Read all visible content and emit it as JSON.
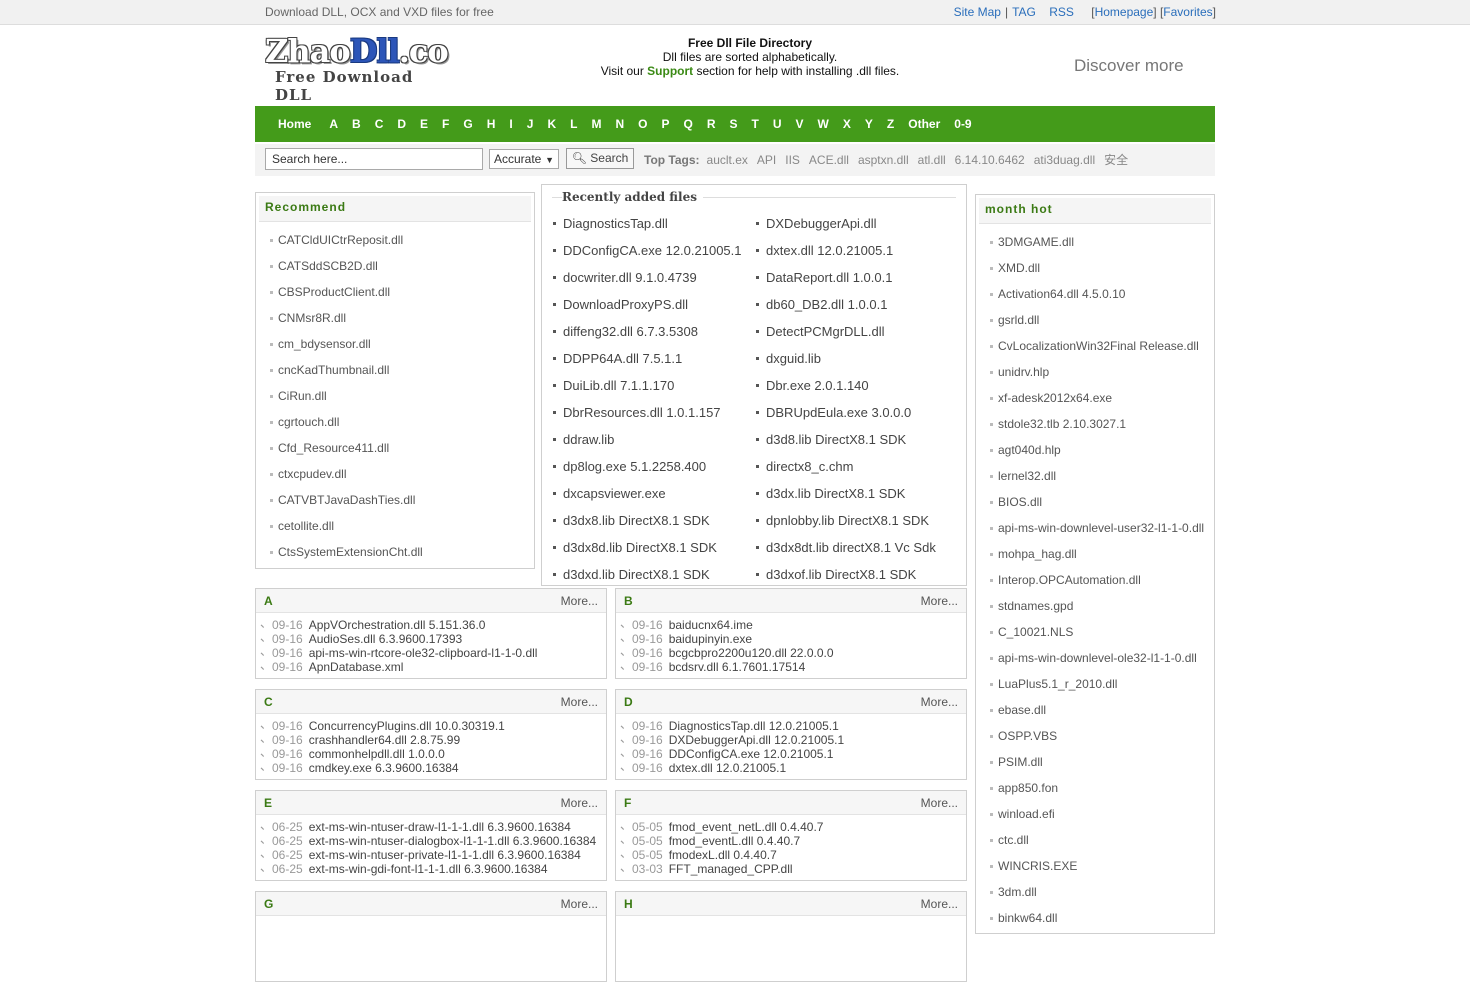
{
  "topbar": {
    "tagline": "Download DLL, OCX and VXD files for free",
    "links": [
      "Site Map",
      "TAG",
      "RSS"
    ],
    "homepage": "Homepage",
    "favorites": "Favorites"
  },
  "logo": {
    "brand_a": "Zhao",
    "brand_b": "Dll",
    "brand_c": ".co",
    "sub": "Free Download DLL"
  },
  "intro": {
    "title": "Free Dll File Directory",
    "line1": "Dll files are sorted alphabetically.",
    "line2_pre": "Visit our ",
    "support": "Support",
    "line2_post": " section for help with installing .dll files."
  },
  "discover": "Discover more",
  "nav": [
    "Home",
    "A",
    "B",
    "C",
    "D",
    "E",
    "F",
    "G",
    "H",
    "I",
    "J",
    "K",
    "L",
    "M",
    "N",
    "O",
    "P",
    "Q",
    "R",
    "S",
    "T",
    "U",
    "V",
    "W",
    "X",
    "Y",
    "Z",
    "Other",
    "0-9"
  ],
  "search": {
    "placeholder": "Search here...",
    "mode": "Accurate",
    "button": "Search",
    "toptags_label": "Top Tags:",
    "tags": [
      "auclt.ex",
      "API",
      "IIS",
      "ACE.dll",
      "asptxn.dll",
      "atl.dll",
      "6.14.10.6462",
      "ati3duag.dll",
      "安全"
    ]
  },
  "recommend": {
    "title": "Recommend",
    "items": [
      "CATCldUICtrReposit.dll",
      "CATSddSCB2D.dll",
      "CBSProductClient.dll",
      "CNMsr8R.dll",
      "cm_bdysensor.dll",
      "cncKadThumbnail.dll",
      "CiRun.dll",
      "cgrtouch.dll",
      "Cfd_Resource411.dll",
      "ctxcpudev.dll",
      "CATVBTJavaDashTies.dll",
      "cetollite.dll",
      "CtsSystemExtensionCht.dll"
    ]
  },
  "recent": {
    "title": "Recently added files",
    "items": [
      "DiagnosticsTap.dll",
      "DXDebuggerApi.dll",
      "DDConfigCA.exe 12.0.21005.1",
      "dxtex.dll 12.0.21005.1",
      "docwriter.dll 9.1.0.4739",
      "DataReport.dll 1.0.0.1",
      "DownloadProxyPS.dll",
      "db60_DB2.dll 1.0.0.1",
      "diffeng32.dll 6.7.3.5308",
      "DetectPCMgrDLL.dll",
      "DDPP64A.dll 7.5.1.1",
      "dxguid.lib",
      "DuiLib.dll 7.1.1.170",
      "Dbr.exe 2.0.1.140",
      "DbrResources.dll 1.0.1.157",
      "DBRUpdEula.exe 3.0.0.0",
      "ddraw.lib",
      "d3d8.lib DirectX8.1 SDK",
      "dp8log.exe 5.1.2258.400",
      "directx8_c.chm",
      "dxcapsviewer.exe",
      "d3dx.lib DirectX8.1 SDK",
      "d3dx8.lib DirectX8.1 SDK",
      "dpnlobby.lib DirectX8.1 SDK",
      "d3dx8d.lib DirectX8.1 SDK",
      "d3dx8dt.lib directX8.1 Vc Sdk",
      "d3dxd.lib DirectX8.1 SDK",
      "d3dxof.lib DirectX8.1 SDK"
    ]
  },
  "more_label": "More...",
  "letters": [
    {
      "letter": "A",
      "rows": [
        {
          "d": "09-16",
          "f": "AppVOrchestration.dll 5.151.36.0"
        },
        {
          "d": "09-16",
          "f": "AudioSes.dll 6.3.9600.17393"
        },
        {
          "d": "09-16",
          "f": "api-ms-win-rtcore-ole32-clipboard-l1-1-0.dll"
        },
        {
          "d": "09-16",
          "f": "ApnDatabase.xml"
        }
      ]
    },
    {
      "letter": "B",
      "rows": [
        {
          "d": "09-16",
          "f": "baiducnx64.ime"
        },
        {
          "d": "09-16",
          "f": "baidupinyin.exe"
        },
        {
          "d": "09-16",
          "f": "bcgcbpro2200u120.dll 22.0.0.0"
        },
        {
          "d": "09-16",
          "f": "bcdsrv.dll 6.1.7601.17514"
        }
      ]
    },
    {
      "letter": "C",
      "rows": [
        {
          "d": "09-16",
          "f": "ConcurrencyPlugins.dll 10.0.30319.1"
        },
        {
          "d": "09-16",
          "f": "crashhandler64.dll 2.8.75.99"
        },
        {
          "d": "09-16",
          "f": "commonhelpdll.dll 1.0.0.0"
        },
        {
          "d": "09-16",
          "f": "cmdkey.exe 6.3.9600.16384"
        }
      ]
    },
    {
      "letter": "D",
      "rows": [
        {
          "d": "09-16",
          "f": "DiagnosticsTap.dll 12.0.21005.1"
        },
        {
          "d": "09-16",
          "f": "DXDebuggerApi.dll 12.0.21005.1"
        },
        {
          "d": "09-16",
          "f": "DDConfigCA.exe 12.0.21005.1"
        },
        {
          "d": "09-16",
          "f": "dxtex.dll 12.0.21005.1"
        }
      ]
    },
    {
      "letter": "E",
      "rows": [
        {
          "d": "06-25",
          "f": "ext-ms-win-ntuser-draw-l1-1-1.dll 6.3.9600.16384"
        },
        {
          "d": "06-25",
          "f": "ext-ms-win-ntuser-dialogbox-l1-1-1.dll 6.3.9600.16384"
        },
        {
          "d": "06-25",
          "f": "ext-ms-win-ntuser-private-l1-1-1.dll 6.3.9600.16384"
        },
        {
          "d": "06-25",
          "f": "ext-ms-win-gdi-font-l1-1-1.dll 6.3.9600.16384"
        }
      ]
    },
    {
      "letter": "F",
      "rows": [
        {
          "d": "05-05",
          "f": "fmod_event_netL.dll 0.4.40.7"
        },
        {
          "d": "05-05",
          "f": "fmod_eventL.dll 0.4.40.7"
        },
        {
          "d": "05-05",
          "f": "fmodexL.dll 0.4.40.7"
        },
        {
          "d": "03-03",
          "f": "FFT_managed_CPP.dll"
        }
      ]
    },
    {
      "letter": "G",
      "rows": []
    },
    {
      "letter": "H",
      "rows": []
    }
  ],
  "monthhot": {
    "title": "month hot",
    "items": [
      "3DMGAME.dll",
      "XMD.dll",
      "Activation64.dll 4.5.0.10",
      "gsrld.dll",
      "CvLocalizationWin32Final Release.dll",
      "unidrv.hlp",
      "xf-adesk2012x64.exe",
      "stdole32.tlb 2.10.3027.1",
      "agt040d.hlp",
      "lernel32.dll",
      "BIOS.dll",
      "api-ms-win-downlevel-user32-l1-1-0.dll",
      "mohpa_hag.dll",
      "Interop.OPCAutomation.dll",
      "stdnames.gpd",
      "C_10021.NLS",
      "api-ms-win-downlevel-ole32-l1-1-0.dll",
      "LuaPlus5.1_r_2010.dll",
      "ebase.dll",
      "OSPP.VBS",
      "PSIM.dll",
      "app850.fon",
      "winload.efi",
      "ctc.dll",
      "WINCRIS.EXE",
      "3dm.dll",
      "binkw64.dll"
    ]
  }
}
